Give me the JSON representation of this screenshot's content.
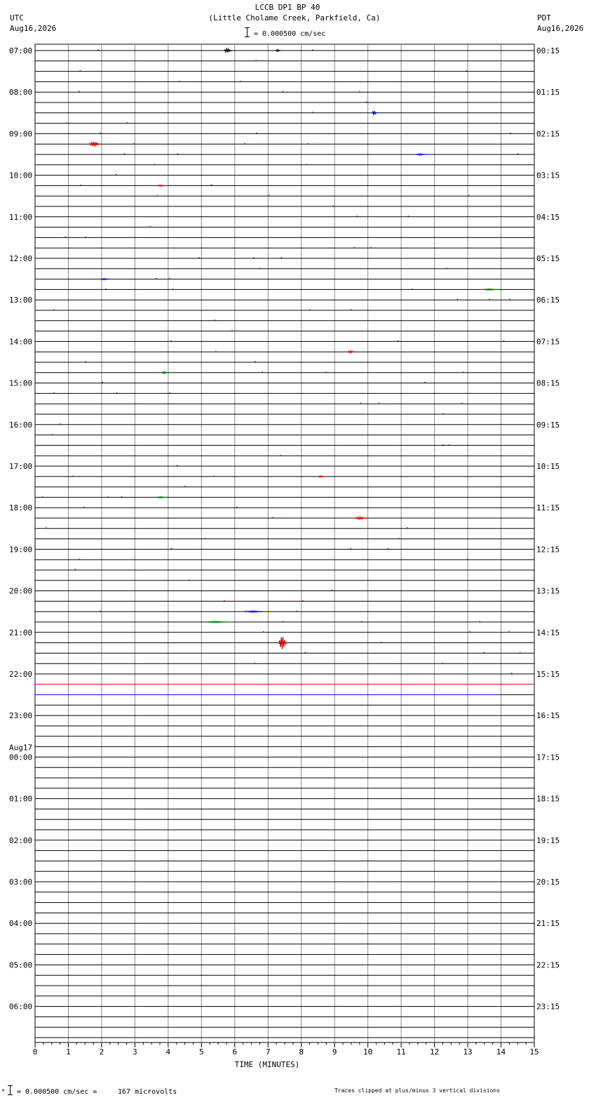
{
  "header": {
    "title": "LCCB DP1 BP 40",
    "subtitle": "(Little Cholame Creek, Parkfield, Ca)",
    "scale_text": "= 0.000500 cm/sec",
    "left_zone": "UTC",
    "left_date": "Aug16,2026",
    "right_zone": "PDT",
    "right_date": "Aug16,2026"
  },
  "footer": {
    "scale_text": "= 0.000500 cm/sec =",
    "microvolts": "167 microvolts",
    "clip_note": "Traces clipped at plus/minus 3 vertical divisions"
  },
  "chart_data": {
    "type": "line",
    "xlabel": "TIME (MINUTES)",
    "xlim": [
      0,
      15
    ],
    "x_ticks": [
      "0",
      "1",
      "2",
      "3",
      "4",
      "5",
      "6",
      "7",
      "8",
      "9",
      "10",
      "11",
      "12",
      "13",
      "14",
      "15"
    ],
    "trace_count": 96,
    "trace_colors": [
      "#000000",
      "#cc0000",
      "#0000cc",
      "#007700"
    ],
    "left_labels": [
      {
        "trace": 0,
        "text": "07:00"
      },
      {
        "trace": 4,
        "text": "08:00"
      },
      {
        "trace": 8,
        "text": "09:00"
      },
      {
        "trace": 12,
        "text": "10:00"
      },
      {
        "trace": 16,
        "text": "11:00"
      },
      {
        "trace": 20,
        "text": "12:00"
      },
      {
        "trace": 24,
        "text": "13:00"
      },
      {
        "trace": 28,
        "text": "14:00"
      },
      {
        "trace": 32,
        "text": "15:00"
      },
      {
        "trace": 36,
        "text": "16:00"
      },
      {
        "trace": 40,
        "text": "17:00"
      },
      {
        "trace": 44,
        "text": "18:00"
      },
      {
        "trace": 48,
        "text": "19:00"
      },
      {
        "trace": 52,
        "text": "20:00"
      },
      {
        "trace": 56,
        "text": "21:00"
      },
      {
        "trace": 60,
        "text": "22:00"
      },
      {
        "trace": 64,
        "text": "23:00"
      },
      {
        "trace": 68,
        "text": "00:00",
        "date": "Aug17"
      },
      {
        "trace": 72,
        "text": "01:00"
      },
      {
        "trace": 76,
        "text": "02:00"
      },
      {
        "trace": 80,
        "text": "03:00"
      },
      {
        "trace": 84,
        "text": "04:00"
      },
      {
        "trace": 88,
        "text": "05:00"
      },
      {
        "trace": 92,
        "text": "06:00"
      }
    ],
    "right_labels": [
      {
        "trace": 0,
        "text": "00:15"
      },
      {
        "trace": 4,
        "text": "01:15"
      },
      {
        "trace": 8,
        "text": "02:15"
      },
      {
        "trace": 12,
        "text": "03:15"
      },
      {
        "trace": 16,
        "text": "04:15"
      },
      {
        "trace": 20,
        "text": "05:15"
      },
      {
        "trace": 24,
        "text": "06:15"
      },
      {
        "trace": 28,
        "text": "07:15"
      },
      {
        "trace": 32,
        "text": "08:15"
      },
      {
        "trace": 36,
        "text": "09:15"
      },
      {
        "trace": 40,
        "text": "10:15"
      },
      {
        "trace": 44,
        "text": "11:15"
      },
      {
        "trace": 48,
        "text": "12:15"
      },
      {
        "trace": 52,
        "text": "13:15"
      },
      {
        "trace": 56,
        "text": "14:15"
      },
      {
        "trace": 60,
        "text": "15:15"
      },
      {
        "trace": 64,
        "text": "16:15"
      },
      {
        "trace": 68,
        "text": "17:15"
      },
      {
        "trace": 72,
        "text": "18:15"
      },
      {
        "trace": 76,
        "text": "19:15"
      },
      {
        "trace": 80,
        "text": "20:15"
      },
      {
        "trace": 84,
        "text": "21:15"
      },
      {
        "trace": 88,
        "text": "22:15"
      },
      {
        "trace": 92,
        "text": "23:15"
      }
    ],
    "live_traces": 62,
    "full_line_traces": [
      {
        "trace": 61,
        "color": "#cc0000",
        "x_end": 15
      },
      {
        "trace": 62,
        "color": "#0000cc",
        "x_end": 14.0
      }
    ],
    "events": [
      {
        "trace": 0,
        "x": 5.8,
        "amp": 2.5,
        "width": 0.25
      },
      {
        "trace": 0,
        "x": 7.3,
        "amp": 1.5,
        "width": 0.15
      },
      {
        "trace": 6,
        "x": 10.2,
        "amp": 3,
        "width": 0.15
      },
      {
        "trace": 9,
        "x": 1.8,
        "amp": 3,
        "width": 0.35
      },
      {
        "trace": 10,
        "x": 11.6,
        "amp": 1,
        "width": 0.3
      },
      {
        "trace": 13,
        "x": 3.8,
        "amp": 1,
        "width": 0.25
      },
      {
        "trace": 22,
        "x": 2.1,
        "amp": 1,
        "width": 0.25
      },
      {
        "trace": 23,
        "x": 13.7,
        "amp": 1,
        "width": 0.5
      },
      {
        "trace": 29,
        "x": 9.5,
        "amp": 1.5,
        "width": 0.2
      },
      {
        "trace": 31,
        "x": 3.9,
        "amp": 1.5,
        "width": 0.2
      },
      {
        "trace": 41,
        "x": 8.6,
        "amp": 1,
        "width": 0.2
      },
      {
        "trace": 43,
        "x": 3.8,
        "amp": 1,
        "width": 0.3
      },
      {
        "trace": 45,
        "x": 9.8,
        "amp": 1.5,
        "width": 0.4
      },
      {
        "trace": 54,
        "x": 6.6,
        "amp": 1,
        "width": 0.5
      },
      {
        "trace": 55,
        "x": 5.5,
        "amp": 1,
        "width": 0.8
      },
      {
        "trace": 57,
        "x": 7.45,
        "amp": 9,
        "width": 0.25
      }
    ]
  }
}
